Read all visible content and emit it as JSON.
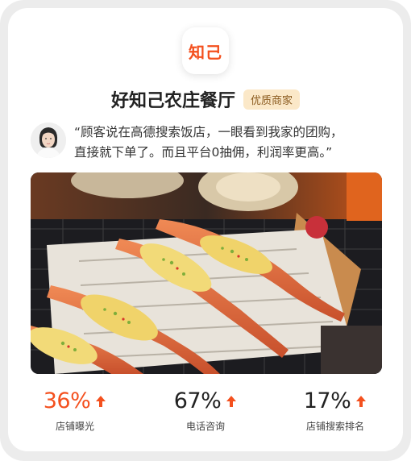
{
  "logo": {
    "text": "知己"
  },
  "store": {
    "name": "好知己农庄餐厅",
    "badge": "优质商家"
  },
  "testimonial": {
    "line1": "“顾客说在高德搜索饭店，一眼看到我家的团购，",
    "line2": "直接就下单了。而且平台0抽佣，利润率更高。”"
  },
  "stats": [
    {
      "value": "36%",
      "label": "店铺曝光",
      "color": "#f4501e"
    },
    {
      "value": "67%",
      "label": "电话咨询",
      "color": "#222222"
    },
    {
      "value": "17%",
      "label": "店铺搜索排名",
      "color": "#222222"
    }
  ],
  "colors": {
    "accent": "#f4501e",
    "badge_bg": "#fbe8c8",
    "badge_text": "#8a5a1e"
  }
}
